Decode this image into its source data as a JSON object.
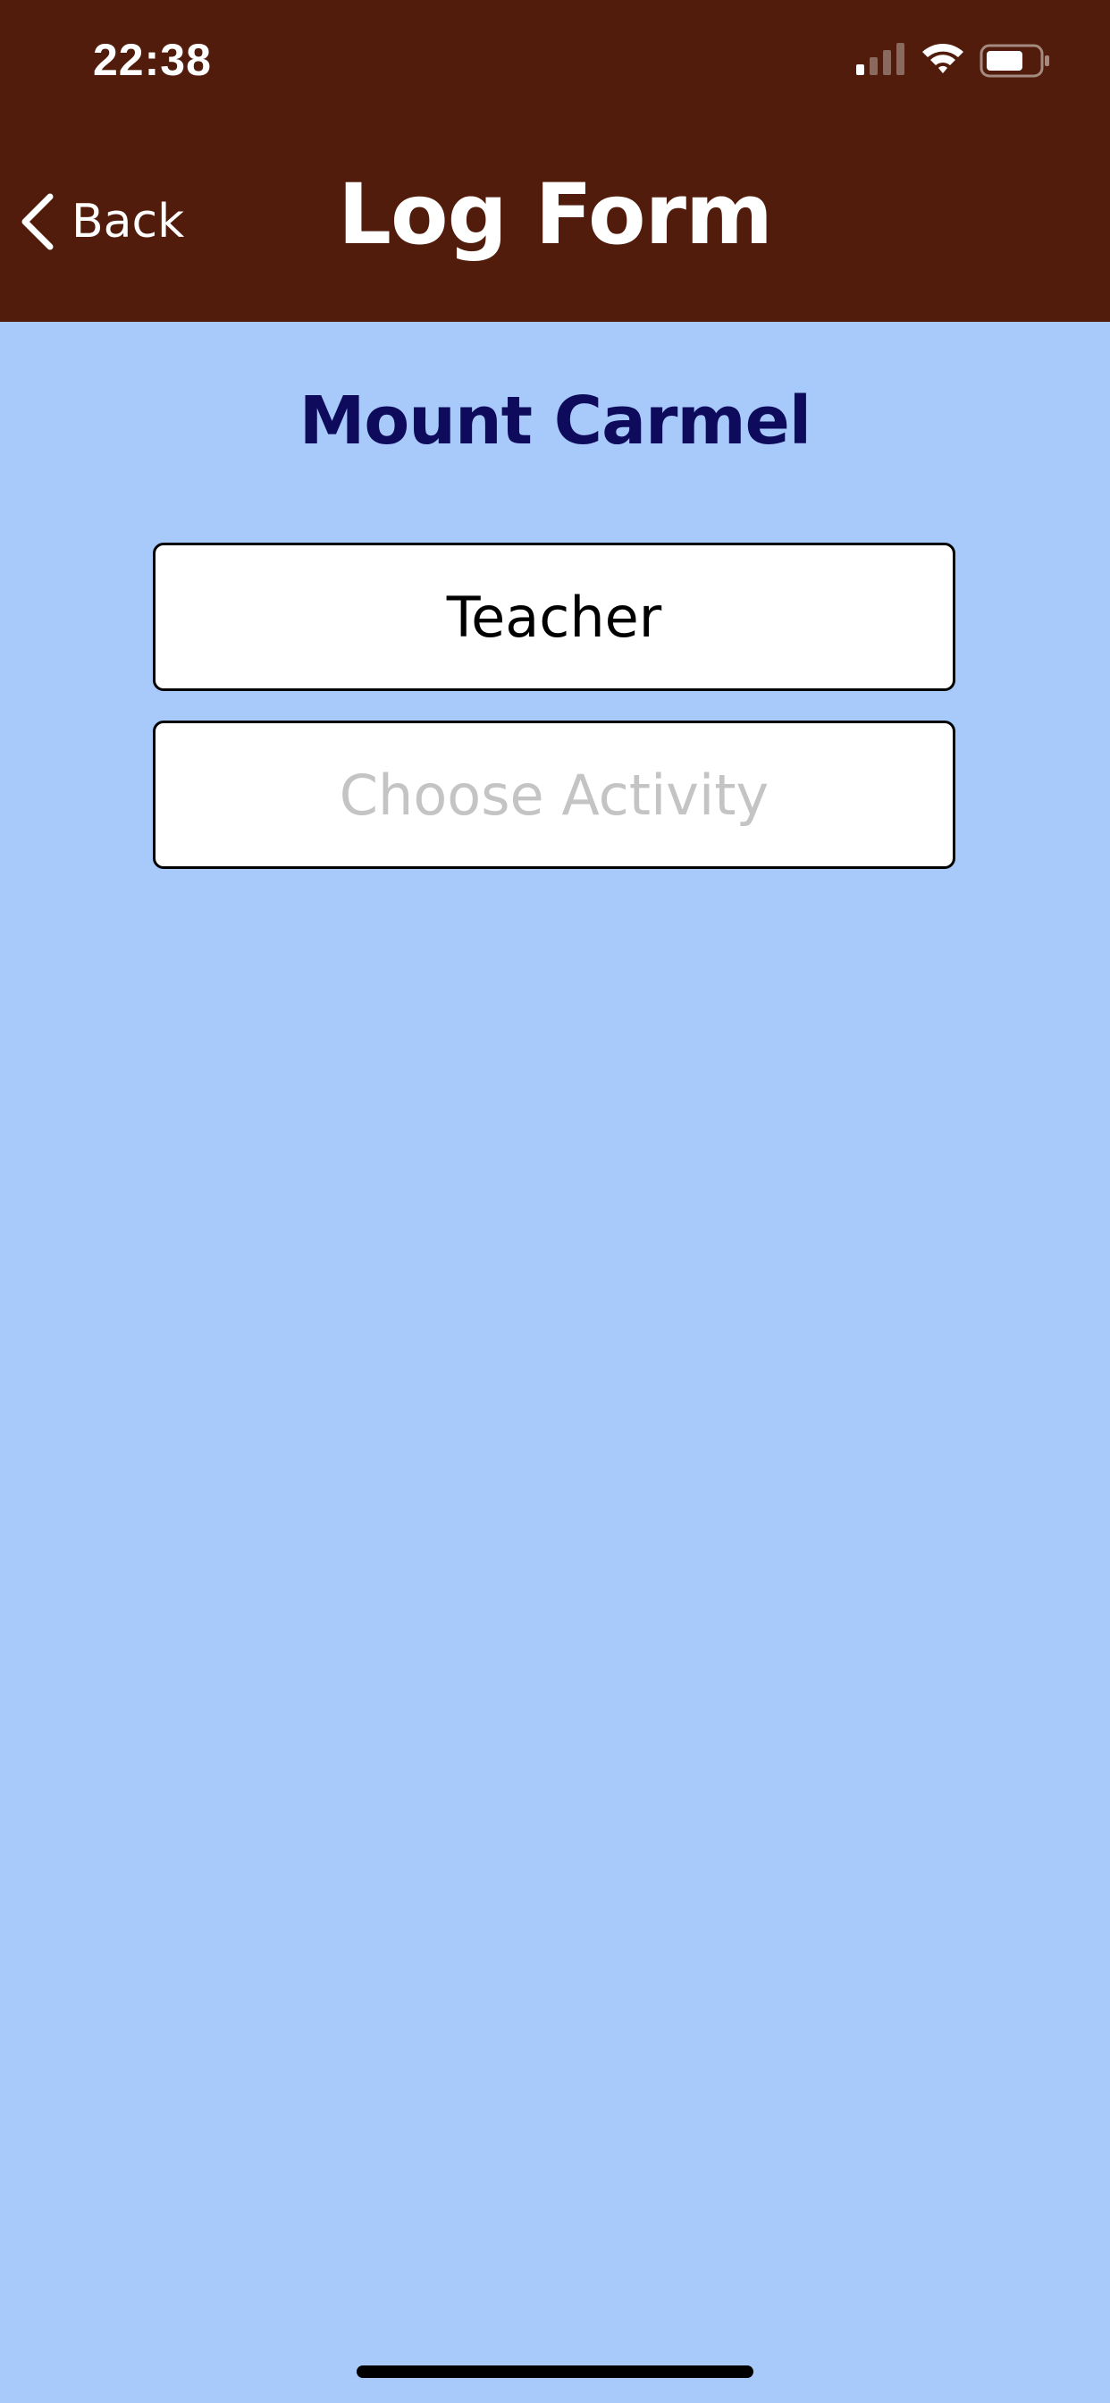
{
  "status_bar": {
    "time": "22:38",
    "signal_icon": "cellular-signal-icon",
    "wifi_icon": "wifi-icon",
    "battery_icon": "battery-icon"
  },
  "nav": {
    "back_label": "Back",
    "back_icon": "chevron-left-icon",
    "title": "Log Form"
  },
  "form": {
    "school_name": "Mount Carmel",
    "role_value": "Teacher",
    "activity_placeholder": "Choose Activity"
  },
  "colors": {
    "header_bg": "#511c0b",
    "page_bg": "#a8cafa",
    "school_name": "#0e0b5c",
    "placeholder": "#c4c4c4"
  }
}
